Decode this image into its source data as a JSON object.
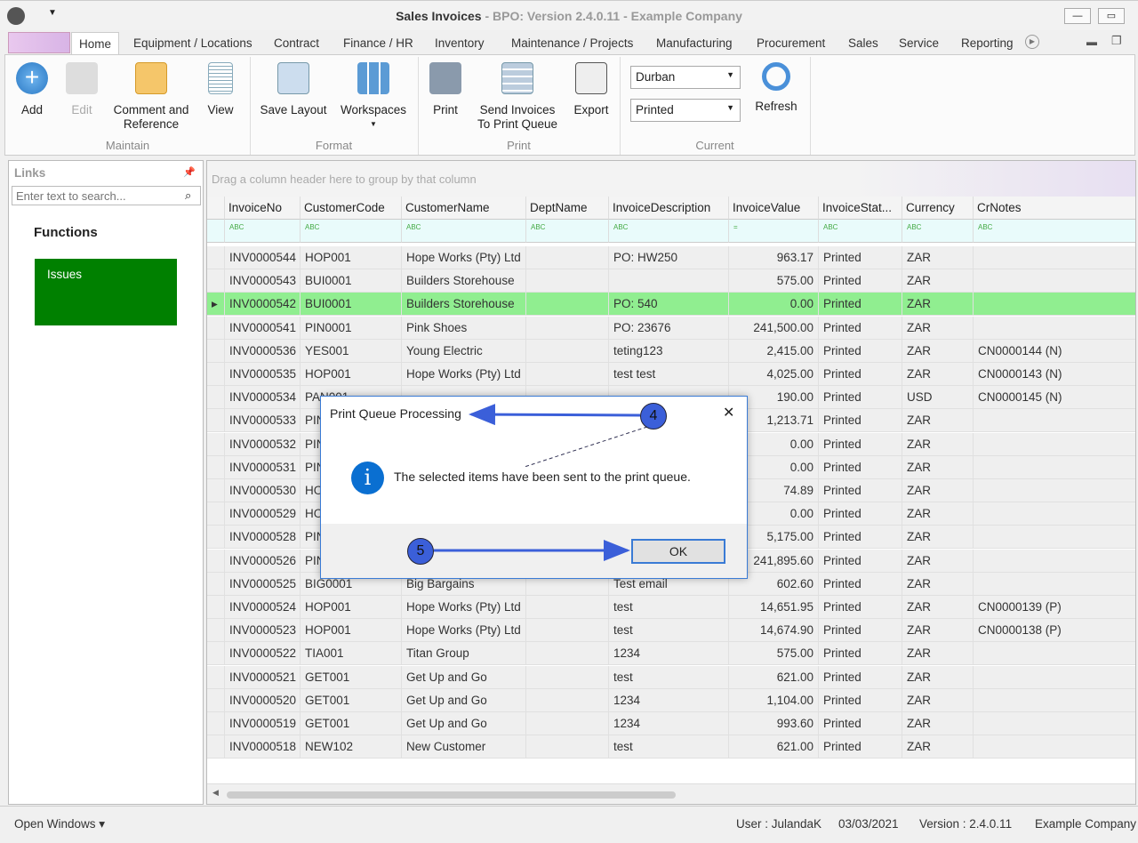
{
  "window": {
    "title": "Sales Invoices",
    "title_rest": " - BPO: Version 2.4.0.11 - Example Company",
    "minimize": "▭",
    "restore": "❐"
  },
  "tabs": [
    "Home",
    "Equipment / Locations",
    "Contract",
    "Finance / HR",
    "Inventory",
    "Maintenance / Projects",
    "Manufacturing",
    "Procurement",
    "Sales",
    "Service",
    "Reporting"
  ],
  "ribbon": {
    "buttons": {
      "add": "Add",
      "edit": "Edit",
      "comment": "Comment and Reference",
      "view": "View",
      "save_layout": "Save Layout",
      "workspaces": "Workspaces",
      "print": "Print",
      "send": "Send Invoices To Print Queue",
      "export": "Export",
      "refresh": "Refresh"
    },
    "groups": {
      "maintain": "Maintain",
      "format": "Format",
      "print": "Print",
      "current": "Current"
    },
    "branch": "Durban",
    "status": "Printed"
  },
  "links": {
    "title": "Links",
    "search_placeholder": "Enter text to search...",
    "functions": "Functions",
    "issues": "Issues",
    "issues_color": "#008000"
  },
  "grid": {
    "group_hint": "Drag a column header here to group by that column",
    "columns": [
      "InvoiceNo",
      "CustomerCode",
      "CustomerName",
      "DeptName",
      "InvoiceDescription",
      "InvoiceValue",
      "InvoiceStat...",
      "Currency",
      "CrNotes"
    ],
    "selected_color": "#90ee90",
    "rows": [
      [
        "INV0000544",
        "HOP001",
        "Hope Works (Pty) Ltd",
        "",
        "PO: HW250",
        "963.17",
        "Printed",
        "ZAR",
        ""
      ],
      [
        "INV0000543",
        "BUI0001",
        "Builders Storehouse",
        "",
        "",
        "575.00",
        "Printed",
        "ZAR",
        ""
      ],
      [
        "INV0000542",
        "BUI0001",
        "Builders Storehouse",
        "",
        "PO: 540",
        "0.00",
        "Printed",
        "ZAR",
        ""
      ],
      [
        "INV0000541",
        "PIN0001",
        "Pink Shoes",
        "",
        "PO: 23676",
        "241,500.00",
        "Printed",
        "ZAR",
        ""
      ],
      [
        "INV0000536",
        "YES001",
        "Young Electric",
        "",
        "teting123",
        "2,415.00",
        "Printed",
        "ZAR",
        "CN0000144 (N)"
      ],
      [
        "INV0000535",
        "HOP001",
        "Hope Works (Pty) Ltd",
        "",
        "test test",
        "4,025.00",
        "Printed",
        "ZAR",
        "CN0000143 (N)"
      ],
      [
        "INV0000534",
        "PAN001",
        "",
        "",
        "",
        "190.00",
        "Printed",
        "USD",
        "CN0000145 (N)"
      ],
      [
        "INV0000533",
        "PIN",
        "",
        "",
        "",
        "1,213.71",
        "Printed",
        "ZAR",
        ""
      ],
      [
        "INV0000532",
        "PIN",
        "",
        "",
        "",
        "0.00",
        "Printed",
        "ZAR",
        ""
      ],
      [
        "INV0000531",
        "PIN",
        "",
        "",
        "",
        "0.00",
        "Printed",
        "ZAR",
        ""
      ],
      [
        "INV0000530",
        "HO",
        "",
        "",
        "",
        "74.89",
        "Printed",
        "ZAR",
        ""
      ],
      [
        "INV0000529",
        "HO",
        "",
        "",
        "",
        "0.00",
        "Printed",
        "ZAR",
        ""
      ],
      [
        "INV0000528",
        "PIN",
        "",
        "",
        "",
        "5,175.00",
        "Printed",
        "ZAR",
        ""
      ],
      [
        "INV0000526",
        "PIN",
        "",
        "",
        "",
        "241,895.60",
        "Printed",
        "ZAR",
        ""
      ],
      [
        "INV0000525",
        "BIG0001",
        "Big Bargains",
        "",
        "Test email",
        "602.60",
        "Printed",
        "ZAR",
        ""
      ],
      [
        "INV0000524",
        "HOP001",
        "Hope Works (Pty) Ltd",
        "",
        "test",
        "14,651.95",
        "Printed",
        "ZAR",
        "CN0000139 (P)"
      ],
      [
        "INV0000523",
        "HOP001",
        "Hope Works (Pty) Ltd",
        "",
        "test",
        "14,674.90",
        "Printed",
        "ZAR",
        "CN0000138 (P)"
      ],
      [
        "INV0000522",
        "TIA001",
        "Titan Group",
        "",
        "1234",
        "575.00",
        "Printed",
        "ZAR",
        ""
      ],
      [
        "INV0000521",
        "GET001",
        "Get Up and Go",
        "",
        "test",
        "621.00",
        "Printed",
        "ZAR",
        ""
      ],
      [
        "INV0000520",
        "GET001",
        "Get Up and Go",
        "",
        "1234",
        "1,104.00",
        "Printed",
        "ZAR",
        ""
      ],
      [
        "INV0000519",
        "GET001",
        "Get Up and Go",
        "",
        "1234",
        "993.60",
        "Printed",
        "ZAR",
        ""
      ],
      [
        "INV0000518",
        "NEW102",
        "New Customer",
        "",
        "test",
        "621.00",
        "Printed",
        "ZAR",
        ""
      ]
    ]
  },
  "dialog": {
    "title": "Print Queue Processing",
    "message": "The selected items have been sent to the print queue.",
    "ok": "OK",
    "close": "✕"
  },
  "annotations": {
    "step4": "4",
    "step5": "5"
  },
  "statusbar": {
    "open_windows": "Open Windows ▾",
    "user": "User : JulandaK",
    "date": "03/03/2021",
    "version": "Version : 2.4.0.11",
    "company": "Example Company"
  }
}
